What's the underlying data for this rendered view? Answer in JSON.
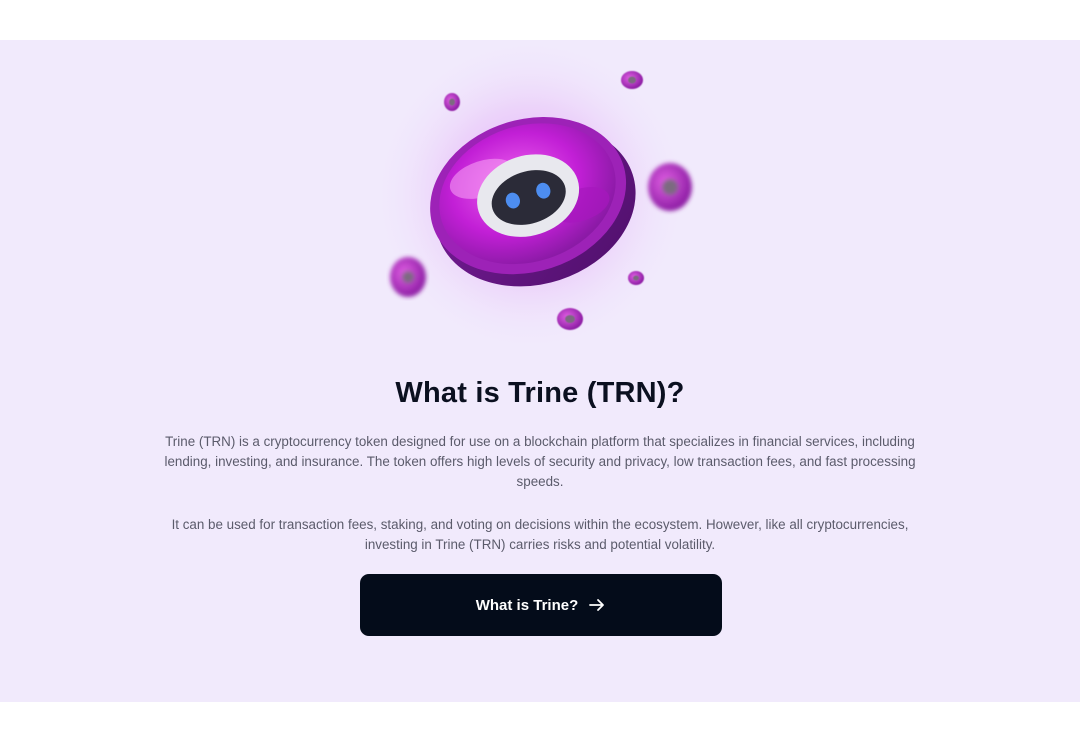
{
  "section": {
    "title": "What is Trine (TRN)?",
    "paragraph_1": "Trine (TRN) is a cryptocurrency token designed for use on a blockchain platform that specializes in financial services, including lending, investing, and insurance. The token offers high levels of security and privacy, low transaction fees, and fast processing speeds.",
    "paragraph_2": "It can be used for transaction fees, staking, and voting on decisions within the ecosystem. However, like all cryptocurrencies, investing in Trine (TRN) carries risks and potential volatility.",
    "cta_label": "What is Trine?",
    "cta_icon": "arrow-right-icon"
  },
  "colors": {
    "section_background": "#f1eafc",
    "title": "#0b1020",
    "body_text": "#5b5b6b",
    "button_background": "#040c1a",
    "button_text": "#ffffff",
    "coin_accent": "#c21fd6"
  }
}
